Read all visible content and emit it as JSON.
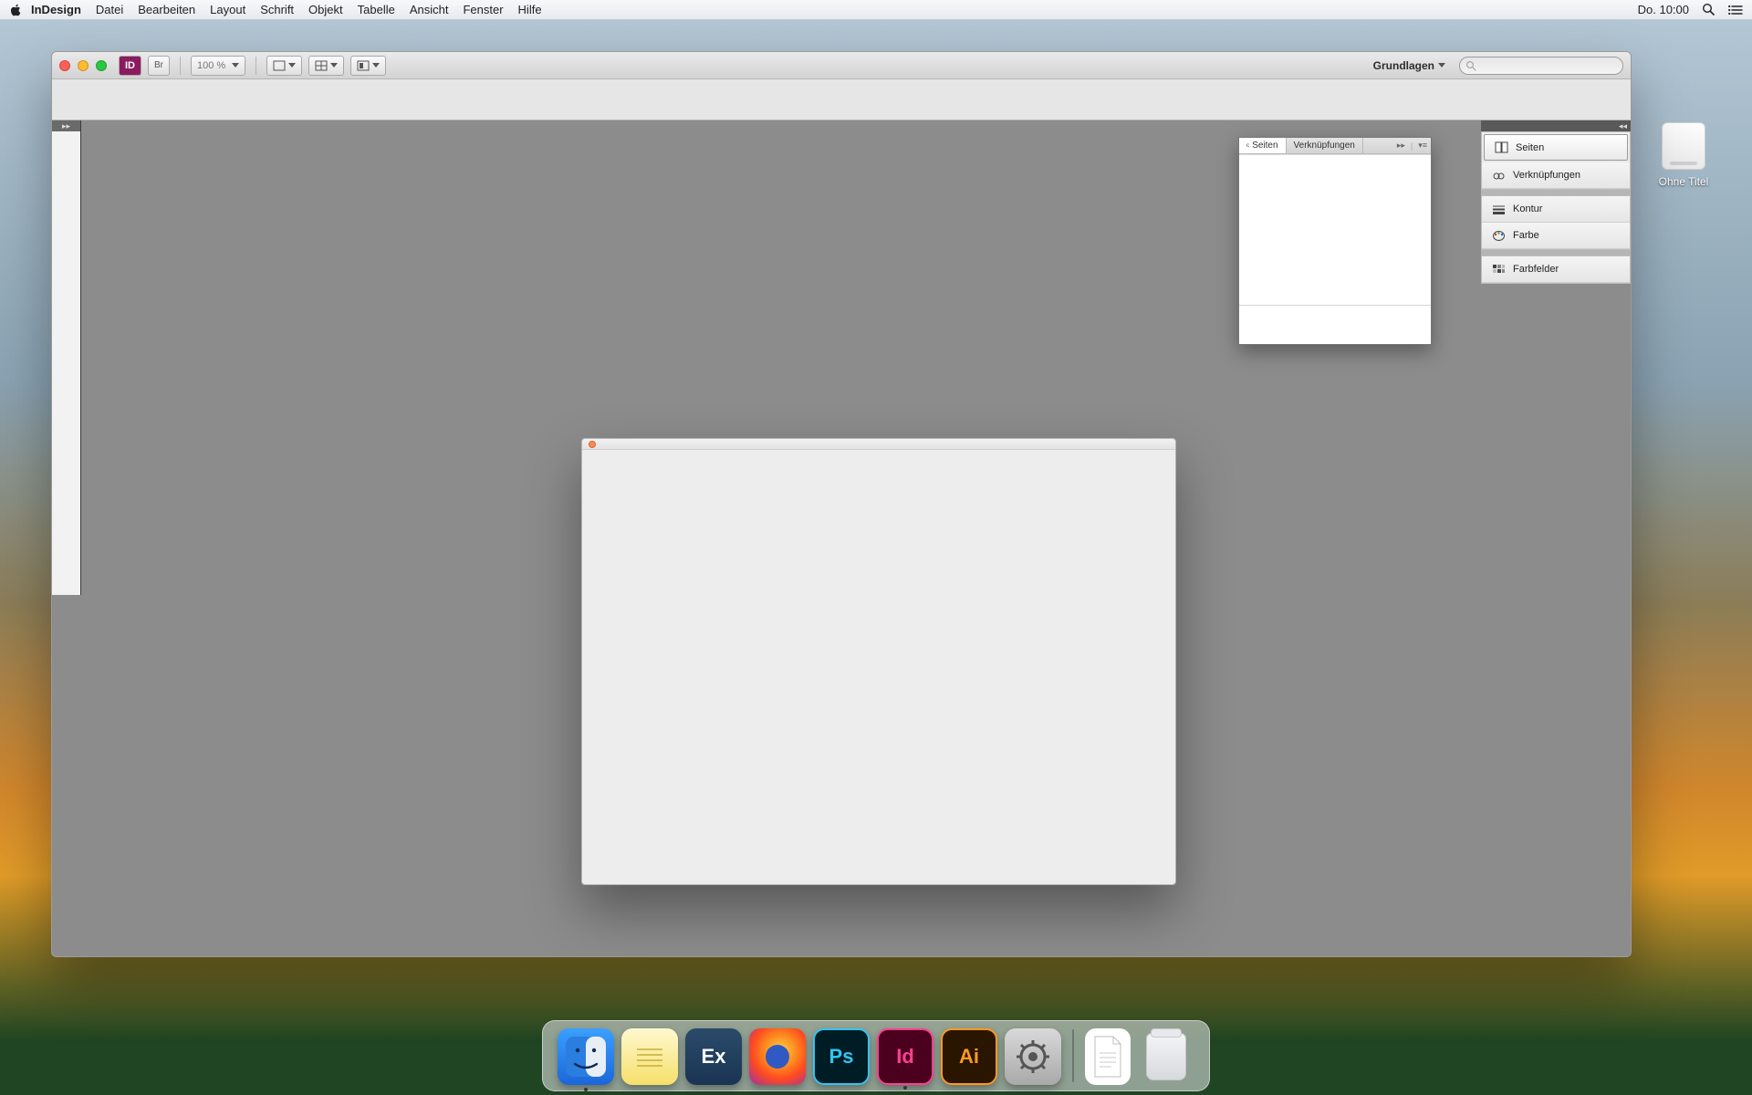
{
  "menubar": {
    "app_name": "InDesign",
    "items": [
      "Datei",
      "Bearbeiten",
      "Layout",
      "Schrift",
      "Objekt",
      "Tabelle",
      "Ansicht",
      "Fenster",
      "Hilfe"
    ],
    "clock": "Do. 10:00"
  },
  "desktop": {
    "drive_label": "Ohne Titel"
  },
  "toolbar": {
    "zoom": "100 %",
    "workspace": "Grundlagen"
  },
  "floating_panel": {
    "tab_active": "Seiten",
    "tab_active_prefix": "ᶜ",
    "tab_inactive": "Verknüpfungen"
  },
  "right_dock": {
    "group1": [
      {
        "icon": "pages",
        "label": "Seiten"
      },
      {
        "icon": "links",
        "label": "Verknüpfungen"
      }
    ],
    "group2": [
      {
        "icon": "stroke",
        "label": "Kontur"
      },
      {
        "icon": "color",
        "label": "Farbe"
      }
    ],
    "group3": [
      {
        "icon": "swatches",
        "label": "Farbfelder"
      }
    ]
  },
  "dock": {
    "apps": [
      {
        "name": "Finder",
        "running": true,
        "class": "finder"
      },
      {
        "name": "Notes",
        "running": false,
        "class": "notes"
      },
      {
        "name": "ExtendScript",
        "running": false,
        "class": "ex",
        "text": "Ex"
      },
      {
        "name": "Firefox",
        "running": false,
        "class": "firefox"
      },
      {
        "name": "Photoshop",
        "running": false,
        "class": "ps",
        "text": "Ps"
      },
      {
        "name": "InDesign",
        "running": true,
        "class": "id",
        "text": "Id"
      },
      {
        "name": "Illustrator",
        "running": false,
        "class": "ai",
        "text": "Ai"
      },
      {
        "name": "System Preferences",
        "running": false,
        "class": "pref"
      }
    ]
  }
}
